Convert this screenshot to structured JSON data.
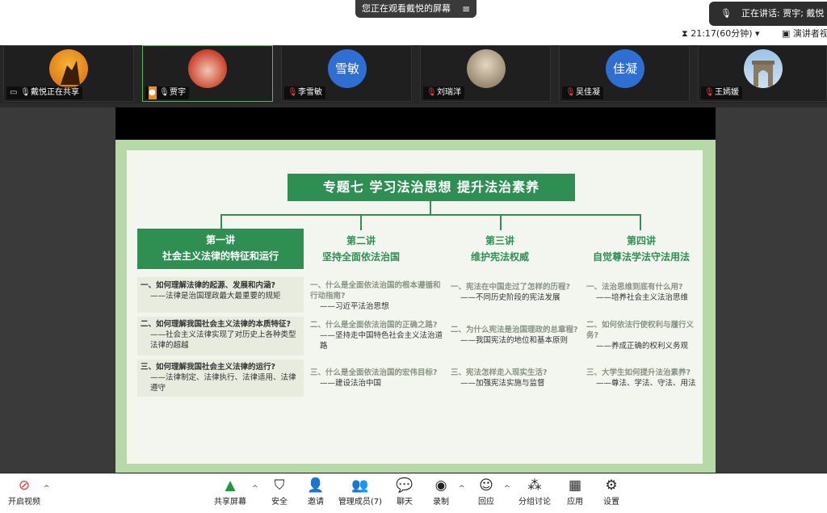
{
  "share_banner": {
    "text": "您正在观看戴悦的屏幕",
    "menu_icon": "≡"
  },
  "speaking": {
    "text": "正在讲话:  贾宇; 戴悦"
  },
  "timer": "21:17(60分钟)",
  "speaker_view": "演讲者视",
  "participants": [
    {
      "name": "戴悦正在共享"
    },
    {
      "name": "贾宇"
    },
    {
      "name": "李雪敏",
      "initials": "雪敏",
      "color": "#2e6fd1"
    },
    {
      "name": "刘瑞洋"
    },
    {
      "name": "吴佳凝",
      "initials": "佳凝",
      "color": "#2e6fd1"
    },
    {
      "name": "王嫣媛"
    }
  ],
  "slide": {
    "title": "专题七   学习法治思想   提升法治素养",
    "lectures": [
      {
        "num": "第一讲",
        "name": "社会主义法律的特征和运行"
      },
      {
        "num": "第二讲",
        "name": "坚持全面依法治国"
      },
      {
        "num": "第三讲",
        "name": "维护宪法权威"
      },
      {
        "num": "第四讲",
        "name": "自觉尊法学法守法用法"
      }
    ],
    "col1": [
      {
        "q": "一、如何理解法律的起源、发展和内涵?",
        "a": "——法律是治国理政最大最重要的规矩"
      },
      {
        "q": "二、如何理解我国社会主义法律的本质特征?",
        "a": "——社会主义法律实现了对历史上各种类型法律的超越"
      },
      {
        "q": "三、如何理解我国社会主义法律的运行?",
        "a": "——法律制定、法律执行、法律适用、法律遵守"
      }
    ],
    "col2": [
      {
        "q": "一、什么是全面依法治国的根本遵循和行动指南?",
        "a": "——习近平法治思想"
      },
      {
        "q": "二、什么是全面依法治国的正确之路?",
        "a": "——坚持走中国特色社会主义法治道路"
      },
      {
        "q": "三、什么是全面依法治国的宏伟目标?",
        "a": "——建设法治中国"
      }
    ],
    "col3": [
      {
        "q": "一、宪法在中国走过了怎样的历程?",
        "a": "——不同历史阶段的宪法发展"
      },
      {
        "q": "二、为什么宪法是治国理政的总章程?",
        "a": "——我国宪法的地位和基本原则"
      },
      {
        "q": "三、宪法怎样走入现实生活?",
        "a": "——加强宪法实施与监督"
      }
    ],
    "col4": [
      {
        "q": "一、法治思维到底有什么用?",
        "a": "——培养社会主义法治思维"
      },
      {
        "q": "二、如何依法行使权利与履行义务?",
        "a": "——养成正确的权利义务观"
      },
      {
        "q": "三、大学生如何提升法治素养?",
        "a": "——尊法、学法、守法、用法"
      }
    ]
  },
  "toolbar": {
    "video": "开启视频",
    "share": "共享屏幕",
    "security": "安全",
    "invite": "邀请",
    "members": "管理成员(7)",
    "chat": "聊天",
    "record": "录制",
    "reactions": "回应",
    "breakout": "分组讨论",
    "apps": "应用",
    "settings": "设置"
  }
}
